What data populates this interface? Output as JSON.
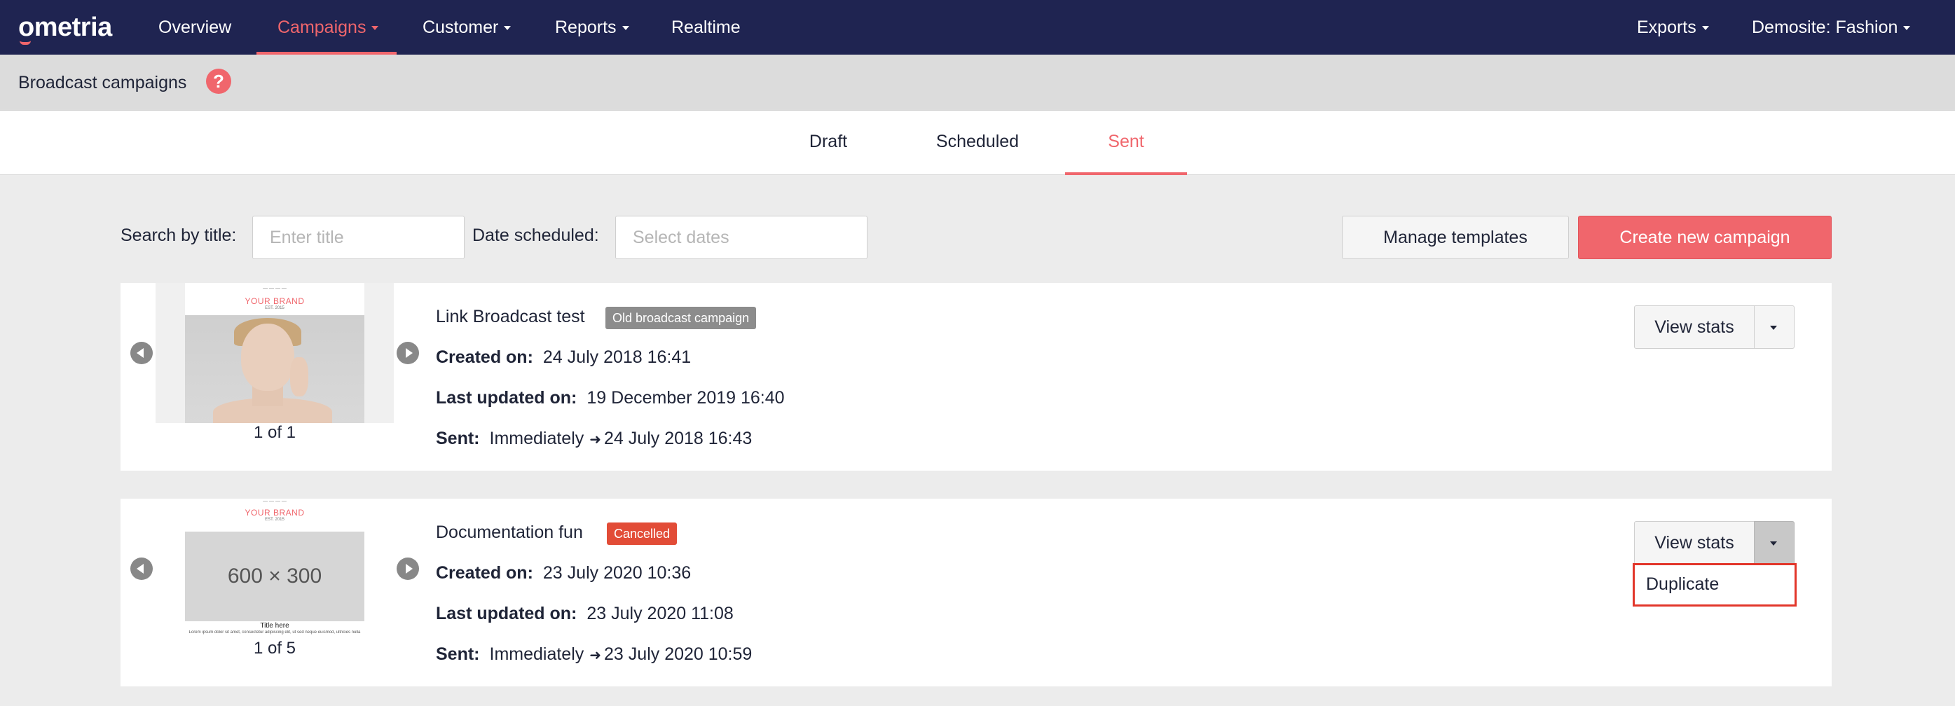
{
  "app": {
    "logo": "ometria"
  },
  "nav": {
    "items": [
      {
        "label": "Overview"
      },
      {
        "label": "Campaigns"
      },
      {
        "label": "Customer"
      },
      {
        "label": "Reports"
      },
      {
        "label": "Realtime"
      }
    ],
    "right": [
      {
        "label": "Exports"
      },
      {
        "label": "Demosite: Fashion"
      }
    ]
  },
  "page": {
    "title": "Broadcast campaigns",
    "help": "?"
  },
  "tabs": [
    {
      "label": "Draft"
    },
    {
      "label": "Scheduled"
    },
    {
      "label": "Sent",
      "active": true
    }
  ],
  "filters": {
    "search_label": "Search by title:",
    "search_placeholder": "Enter title",
    "date_label": "Date scheduled:",
    "date_placeholder": "Select dates"
  },
  "actions": {
    "manage": "Manage templates",
    "create": "Create new campaign"
  },
  "campaigns": [
    {
      "title": "Link Broadcast test",
      "badge": "Old broadcast campaign",
      "pager": "1 of 1",
      "thumb": {
        "brand": "YOUR BRAND",
        "est": "EST. 2015"
      },
      "created_label": "Created on:",
      "created": "24 July 2018 16:41",
      "updated_label": "Last updated on:",
      "updated": "19 December 2019 16:40",
      "sent_label": "Sent:",
      "sent_mode": "Immediately",
      "sent_at": "24 July 2018 16:43",
      "view_stats": "View stats"
    },
    {
      "title": "Documentation fun",
      "badge": "Cancelled",
      "pager": "1 of 5",
      "thumb": {
        "brand": "YOUR BRAND",
        "est": "EST. 2015",
        "placeholder": "600 × 300",
        "title_here": "Title here",
        "lorem": "Lorem ipsum dolor sit amet, consectetur adipiscing elit, ut sed neque euismod, ultricies nulla"
      },
      "created_label": "Created on:",
      "created": "23 July 2020 10:36",
      "updated_label": "Last updated on:",
      "updated": "23 July 2020 11:08",
      "sent_label": "Sent:",
      "sent_mode": "Immediately",
      "sent_at": "23 July 2020 10:59",
      "view_stats": "View stats",
      "menu_item": "Duplicate"
    }
  ],
  "colors": {
    "navbar": "#1f2451",
    "accent": "#f0666c",
    "cancelled": "#e24c37",
    "old_badge": "#8c8c8c"
  }
}
